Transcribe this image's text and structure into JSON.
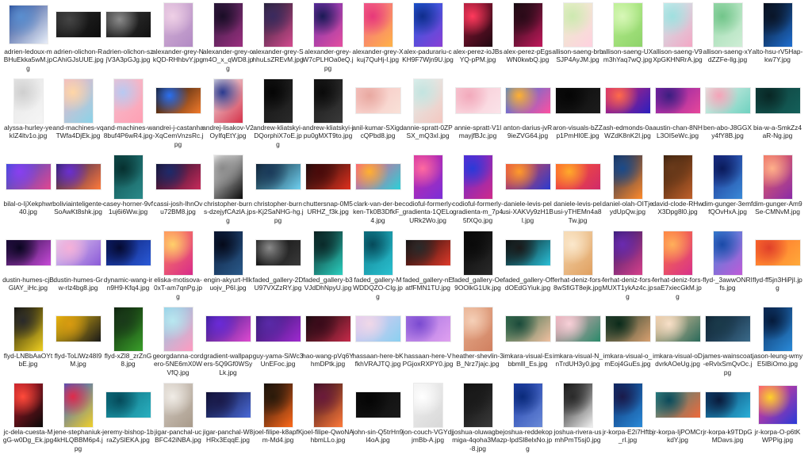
{
  "files": [
    {
      "name": "adrien-ledoux-mBHuEkka5wM.jpg",
      "shape": "square",
      "colors": [
        "#1f3f8f",
        "#e8eef8",
        "#5a8fd0"
      ]
    },
    {
      "name": "adrien-olichon-RCAhiGJsUUE.jpg",
      "shape": "landscape",
      "colors": [
        "#2a2a2a",
        "#0d0d0d",
        "#444444"
      ]
    },
    {
      "name": "adrien-olichon-szjV3A3pGJg.jpg",
      "shape": "landscape",
      "colors": [
        "#3a3a3a",
        "#111111",
        "#8a8a8a"
      ]
    },
    {
      "name": "alexander-grey-NkQD-RHhbvY.jpg",
      "shape": "portrait",
      "colors": [
        "#d9b8d8",
        "#b28ac4",
        "#efd0e6"
      ]
    },
    {
      "name": "alexander-grey-om4O_x_qWD8.jpg",
      "shape": "portrait",
      "colors": [
        "#2c1a3e",
        "#9b2f7f",
        "#1a0d26"
      ]
    },
    {
      "name": "alexander-grey-ShhuLsZREvM.jpg",
      "shape": "portrait",
      "colors": [
        "#1e1e30",
        "#d44b8f",
        "#3a2a5e"
      ]
    },
    {
      "name": "alexander-grey-W7cPLHOa0eQ.jpg",
      "shape": "portrait",
      "colors": [
        "#6a2fb0",
        "#e54fa0",
        "#1b1a55"
      ]
    },
    {
      "name": "alexander-grey-Xkuj7QuHj-I.jpg",
      "shape": "portrait",
      "colors": [
        "#f25f8e",
        "#ffb347",
        "#e7387a"
      ]
    },
    {
      "name": "alex-padurariu-cKH9F7Wjn9U.jpg",
      "shape": "portrait",
      "colors": [
        "#1d5fe0",
        "#8a3fd6",
        "#0f2d8c"
      ]
    },
    {
      "name": "alex-perez-ioJBsYQ-pPM.jpg",
      "shape": "portrait",
      "colors": [
        "#a01838",
        "#200812",
        "#ff3a5c"
      ]
    },
    {
      "name": "alex-perez-pEgsWN0kwbQ.jpg",
      "shape": "portrait",
      "colors": [
        "#0c0c0c",
        "#c2185b",
        "#2a0a18"
      ]
    },
    {
      "name": "allison-saeng-brbSJP4AyJM.jpg",
      "shape": "portrait",
      "colors": [
        "#e8f2c8",
        "#ffd1e0",
        "#cde9b0"
      ]
    },
    {
      "name": "allison-saeng-UXm3hYaq7wQ.jpg",
      "shape": "portrait",
      "colors": [
        "#b9ef8f",
        "#8ed36a",
        "#d8f7b8"
      ]
    },
    {
      "name": "allison-saeng-V9XpGKHNRrA.jpg",
      "shape": "portrait",
      "colors": [
        "#c6f0ef",
        "#f4a6c4",
        "#9fe0df"
      ]
    },
    {
      "name": "allison-saeng-xYdZZFe-llg.jpg",
      "shape": "portrait",
      "colors": [
        "#9ad9ac",
        "#cfeed6",
        "#72c58a"
      ]
    },
    {
      "name": "alto-hsu-rV5Hap-kw7Y.jpg",
      "shape": "portrait",
      "colors": [
        "#050a14",
        "#1f6fd1",
        "#0a1528"
      ]
    },
    {
      "name": "alyssa-hurley-yekIZ4ltv1o.jpg",
      "shape": "portrait",
      "colors": [
        "#e6e6e6",
        "#f5f5f5",
        "#cfcfcf"
      ]
    },
    {
      "name": "and-machines-vqTWfa4DjEk.jpg",
      "shape": "portrait",
      "colors": [
        "#f0b7c8",
        "#8ad3e8",
        "#ffd6a6"
      ]
    },
    {
      "name": "and-machines-w8buf4P6wR4.jpg",
      "shape": "portrait",
      "colors": [
        "#f2c2d0",
        "#ff9fb3",
        "#b8c9f2"
      ]
    },
    {
      "name": "andrei-j-castanha-XqCemVnzsRc.jpg",
      "shape": "landscape",
      "colors": [
        "#0a0a0a",
        "#f27a2a",
        "#2a6ff0"
      ]
    },
    {
      "name": "andrej-lisakov-V2OyIfqEtY.jpg",
      "shape": "portrait",
      "colors": [
        "#f2f2f2",
        "#d6324a",
        "#2a3a8f"
      ]
    },
    {
      "name": "andrew-kliatskyi-DQorphiX7oE.jpg",
      "shape": "portrait",
      "colors": [
        "#101010",
        "#2a2a2a",
        "#050505"
      ]
    },
    {
      "name": "andrew-kliatskyi-jpu0gMXT9to.jpg",
      "shape": "portrait",
      "colors": [
        "#151515",
        "#3a3a3a",
        "#0a0a0a"
      ]
    },
    {
      "name": "anil-kumar-SXigdcQPbd8.jpg",
      "shape": "landscape",
      "colors": [
        "#f6c3c0",
        "#f9e1d8",
        "#e8a8a0"
      ]
    },
    {
      "name": "annie-spratt-0ZPSX_mQ3xI.jpg",
      "shape": "portrait",
      "colors": [
        "#dff2ef",
        "#f4c7c0",
        "#c3e4e0"
      ]
    },
    {
      "name": "annie-spratt-V1lmayjfBJc.jpg",
      "shape": "landscape",
      "colors": [
        "#f7c7d2",
        "#fbe3e9",
        "#f2a9bb"
      ]
    },
    {
      "name": "anton-darius-jvR9ieZVG64.jpg",
      "shape": "landscape",
      "colors": [
        "#2f7de1",
        "#ff4fa0",
        "#ffb030"
      ]
    },
    {
      "name": "aron-visuals-bZZp1PmHI0E.jpg",
      "shape": "landscape",
      "colors": [
        "#0a0a0a",
        "#1c1c1c",
        "#050505"
      ]
    },
    {
      "name": "ash-edmonds-0aWZdK8nK2I.jpg",
      "shape": "landscape",
      "colors": [
        "#d6246e",
        "#2a1fbf",
        "#ff6a4a"
      ]
    },
    {
      "name": "austin-chan-8NHL3OI5eWc.jpg",
      "shape": "landscape",
      "colors": [
        "#7a1fa8",
        "#e8479a",
        "#3b1e80"
      ]
    },
    {
      "name": "ben-abo-J8GGXy4fY8B.jpg",
      "shape": "landscape",
      "colors": [
        "#e7f0e8",
        "#6ed2c0",
        "#f5a3b8"
      ]
    },
    {
      "name": "bia-w-a-SmkZz4aR-Ng.jpg",
      "shape": "landscape",
      "colors": [
        "#0e3d3a",
        "#14605a",
        "#082624"
      ]
    },
    {
      "name": "bilal-o-IjXekphwr40.jpg",
      "shape": "landscape",
      "colors": [
        "#2a4fd8",
        "#e2478f",
        "#8a3ff0"
      ]
    },
    {
      "name": "boliviainteligente-SoAwKt8shk.jpg",
      "shape": "landscape",
      "colors": [
        "#1a1a60",
        "#ff7a3a",
        "#6a2fd0"
      ]
    },
    {
      "name": "casey-horner-9vf1uj6i6Ww.jpg",
      "shape": "portrait",
      "colors": [
        "#0e4a4a",
        "#2a8a8a",
        "#06302f"
      ]
    },
    {
      "name": "cassi-josh-lhnOvu72BM8.jpg",
      "shape": "landscape",
      "colors": [
        "#0a0f2a",
        "#c82a5a",
        "#1e2a6a"
      ]
    },
    {
      "name": "christopher-burns-dzejyfCAzlA.jpg",
      "shape": "portrait",
      "colors": [
        "#ffffff",
        "#0a0a0a",
        "#8a8a8a"
      ]
    },
    {
      "name": "christopher-burns-Kj2SaNHG-hg.jpg",
      "shape": "landscape",
      "colors": [
        "#0a1a2a",
        "#6fd0f0",
        "#1a3a5a"
      ]
    },
    {
      "name": "chuttersnap-0M5URHZ_f3k.jpg",
      "shape": "landscape",
      "colors": [
        "#0a0a0a",
        "#e0301e",
        "#4a0a0a"
      ]
    },
    {
      "name": "clark-van-der-beken-Tk0B3DfkF_4.jpg",
      "shape": "landscape",
      "colors": [
        "#ff4f8a",
        "#2ad0d8",
        "#ffb030"
      ]
    },
    {
      "name": "codioful-formerly-gradienta-1QELoURk2Wo.jpg",
      "shape": "portrait",
      "colors": [
        "#d02aa0",
        "#7a2fd8",
        "#ff6aa0"
      ]
    },
    {
      "name": "codioful-formerly-gradienta-m_7p45fXQo.jpg",
      "shape": "portrait",
      "colors": [
        "#5a2ad8",
        "#d02a8a",
        "#2a3ad8"
      ]
    },
    {
      "name": "daniele-levis-pelusi-XAKVy9zH1Bl.jpg",
      "shape": "landscape",
      "colors": [
        "#f04a3a",
        "#2a3ad0",
        "#ff9a2a"
      ]
    },
    {
      "name": "daniele-levis-pelusi-yTHEMn4a8Tw.jpg",
      "shape": "landscape",
      "colors": [
        "#ff5a2a",
        "#d02a6a",
        "#ffaa2a"
      ]
    },
    {
      "name": "daniel-olah-OITjeydUpQw.jpg",
      "shape": "portrait",
      "colors": [
        "#0a2a5a",
        "#ff8a2a",
        "#1a4a8a"
      ]
    },
    {
      "name": "david-clode-RHwX3Dpg8l0.jpg",
      "shape": "portrait",
      "colors": [
        "#2a1a0a",
        "#c0602a",
        "#6a3a1a"
      ]
    },
    {
      "name": "dim-gunger-3emffQOvHxA.jpg",
      "shape": "portrait",
      "colors": [
        "#1a2a8a",
        "#3a8ad8",
        "#0a1a5a"
      ]
    },
    {
      "name": "dim-gunger-Am9Se-CMNvM.jpg",
      "shape": "portrait",
      "colors": [
        "#f06a5a",
        "#8a2aa8",
        "#ffb08a"
      ]
    },
    {
      "name": "dustin-humes-cjBGlAY_iHc.jpg",
      "shape": "landscape",
      "colors": [
        "#1a0a3a",
        "#c84ad8",
        "#0a0520"
      ]
    },
    {
      "name": "dustin-humes-Grw-rlz4bg8.jpg",
      "shape": "landscape",
      "colors": [
        "#e8d0f0",
        "#8a5ad8",
        "#f5b0d8"
      ]
    },
    {
      "name": "dynamic-wang-irn9H9-Kfq4.jpg",
      "shape": "landscape",
      "colors": [
        "#0a1a6a",
        "#2a5ad8",
        "#050a30"
      ]
    },
    {
      "name": "eliska-motisova-0xT-am7qnPg.jpg",
      "shape": "portrait",
      "colors": [
        "#ff8a5a",
        "#d82a8a",
        "#ffd06a"
      ]
    },
    {
      "name": "engin-akyurt-Hlkuojv_P6I.jpg",
      "shape": "portrait",
      "colors": [
        "#0a1a3a",
        "#2a5a8a",
        "#050a1a"
      ]
    },
    {
      "name": "faded_gallery-2DU97VXZzRY.jpg",
      "shape": "landscape",
      "colors": [
        "#0a0a0a",
        "#3a3a3a",
        "#8a8a8a"
      ]
    },
    {
      "name": "faded_gallery-b3VJdDhNpyU.jpg",
      "shape": "portrait",
      "colors": [
        "#0a1a1a",
        "#2ad0c0",
        "#0a2a2a"
      ]
    },
    {
      "name": "faded_gallery-MWDDQZO-CIg.jpg",
      "shape": "portrait",
      "colors": [
        "#0e7a8a",
        "#2ac0d0",
        "#064a5a"
      ]
    },
    {
      "name": "faded_gallery-nEatfFMN1TU.jpg",
      "shape": "landscape",
      "colors": [
        "#0a0a0a",
        "#e03a2a",
        "#2a2a2a"
      ]
    },
    {
      "name": "faded_gallery-Oe9OOlkG1Uk.jpg",
      "shape": "portrait",
      "colors": [
        "#050505",
        "#2a2a2a",
        "#0a0a0a"
      ]
    },
    {
      "name": "faded_gallery-OfdOEdGYiuk.jpg",
      "shape": "landscape",
      "colors": [
        "#0a0a0a",
        "#2ac0d8",
        "#1a1a1a"
      ]
    },
    {
      "name": "ferhat-deniz-fors-8wSfiGT8ejk.jpg",
      "shape": "portrait",
      "colors": [
        "#f5d8b0",
        "#e0a060",
        "#fbe8cc"
      ]
    },
    {
      "name": "ferhat-deniz-fors-MUXT1ykAz4c.jpg",
      "shape": "portrait",
      "colors": [
        "#2a1a6a",
        "#d8408a",
        "#6a2ab0"
      ]
    },
    {
      "name": "ferhat-deniz-fors-saE7xiecGkM.jpg",
      "shape": "portrait",
      "colors": [
        "#ff7a3a",
        "#d8308a",
        "#ffb05a"
      ]
    },
    {
      "name": "flyd-_3awwONRIfs.jpg",
      "shape": "portrait",
      "colors": [
        "#3a8ad8",
        "#c05ad8",
        "#1a4aa8"
      ]
    },
    {
      "name": "flyd-ff5jn3HiPjI.jpg",
      "shape": "landscape",
      "colors": [
        "#ff6a2a",
        "#ffaa3a",
        "#e0402a"
      ]
    },
    {
      "name": "flyd-LNBbAaOYtbE.jpg",
      "shape": "portrait",
      "colors": [
        "#0a0a0a",
        "#f0d020",
        "#2a2a2a"
      ]
    },
    {
      "name": "flyd-ToLlWz48I9M.jpg",
      "shape": "landscape",
      "colors": [
        "#f0c010",
        "#1a1a1a",
        "#d89a10"
      ]
    },
    {
      "name": "flyd-xZl8_zrZnG8.jpg",
      "shape": "portrait",
      "colors": [
        "#0a1a0a",
        "#3aa02a",
        "#1a3a1a"
      ]
    },
    {
      "name": "georgdanna-cordero-5NE6mX0WVfQ.jpg",
      "shape": "portrait",
      "colors": [
        "#8ad0e8",
        "#ff9ac0",
        "#b8e8f0"
      ]
    },
    {
      "name": "gradient-wallpapers-5Q9Gf0WSyLk.jpg",
      "shape": "landscape",
      "colors": [
        "#2a1a8a",
        "#e04ad0",
        "#6a2ad8"
      ]
    },
    {
      "name": "guy-yama-SiWc3UnEFoc.jpg",
      "shape": "landscape",
      "colors": [
        "#2a1a6a",
        "#a02ad0",
        "#5a2aa8"
      ]
    },
    {
      "name": "hao-wang-pVq6YhmDPtk.jpg",
      "shape": "landscape",
      "colors": [
        "#0a0a0a",
        "#c82a4a",
        "#3a0a1a"
      ]
    },
    {
      "name": "hassaan-here-bKfkhVRAJTQ.jpg",
      "shape": "landscape",
      "colors": [
        "#e8c8f0",
        "#8ad0f0",
        "#f0d8e8"
      ]
    },
    {
      "name": "hassaan-here-VPGjoxRXPY0.jpg",
      "shape": "landscape",
      "colors": [
        "#a070e0",
        "#e0a0f0",
        "#7a4ad0"
      ]
    },
    {
      "name": "heather-shevlin-3B_Nrz7jajc.jpg",
      "shape": "portrait",
      "colors": [
        "#e8b090",
        "#d08060",
        "#f5d0b8"
      ]
    },
    {
      "name": "imkara-visual-Esbbmlll_Es.jpg",
      "shape": "landscape",
      "colors": [
        "#2a6a4a",
        "#f0c0a0",
        "#1a4a3a"
      ]
    },
    {
      "name": "imkara-visual-N_nTrdUH3y0.jpg",
      "shape": "landscape",
      "colors": [
        "#f0a8b8",
        "#2a8a6a",
        "#f8d0d8"
      ]
    },
    {
      "name": "imkara-visual-o_mEoj4GuEs.jpg",
      "shape": "landscape",
      "colors": [
        "#1a3a2a",
        "#d8a070",
        "#0a2a1a"
      ]
    },
    {
      "name": "imkara-visual-oDdvrkAOeUg.jpg",
      "shape": "landscape",
      "colors": [
        "#f0c8a0",
        "#2a6a5a",
        "#f8e0c8"
      ]
    },
    {
      "name": "james-wainscoat-eRvlxSmQvOc.jpg",
      "shape": "landscape",
      "colors": [
        "#0a1a2a",
        "#3a6a8a",
        "#1a3a4a"
      ]
    },
    {
      "name": "jason-leung-wmyE5lBiOmo.jpg",
      "shape": "portrait",
      "colors": [
        "#0a2a5a",
        "#2a8ad8",
        "#051a3a"
      ]
    },
    {
      "name": "jc-dela-cuesta-MgG-w0Dg_Ek.jpg",
      "shape": "portrait",
      "colors": [
        "#c01a2a",
        "#0a0a0a",
        "#ff4a3a"
      ]
    },
    {
      "name": "jene-stephaniuk-4kHLQBBM6p4.jpg",
      "shape": "portrait",
      "colors": [
        "#2a5ad8",
        "#f0d02a",
        "#e02a4a"
      ]
    },
    {
      "name": "jeremy-bishop-1braZySlEKA.jpg",
      "shape": "landscape",
      "colors": [
        "#0a6a7a",
        "#2ab0c0",
        "#054a5a"
      ]
    },
    {
      "name": "jigar-panchal-ucBFC42iNBA.jpg",
      "shape": "portrait",
      "colors": [
        "#d8d0c8",
        "#a89a8a",
        "#f0ece6"
      ]
    },
    {
      "name": "jigar-panchal-W8HRx3EqqE.jpg",
      "shape": "landscape",
      "colors": [
        "#0a0a2a",
        "#4a6ad8",
        "#1a1a4a"
      ]
    },
    {
      "name": "joel-filipe-k8apfKm-Md4.jpg",
      "shape": "portrait",
      "colors": [
        "#0a0a0a",
        "#ff6a1a",
        "#2a1a0a"
      ]
    },
    {
      "name": "joel-filipe-QwoNAhbmLLo.jpg",
      "shape": "portrait",
      "colors": [
        "#2a0a1a",
        "#ff7a3a",
        "#6a1a3a"
      ]
    },
    {
      "name": "john-sin-Q5trHn9l4oA.jpg",
      "shape": "landscape",
      "colors": [
        "#0a0a0a",
        "#1a1a1a",
        "#050505"
      ]
    },
    {
      "name": "jon-couch-VGYdjjmBb-A.jpg",
      "shape": "portrait",
      "colors": [
        "#f0f0f0",
        "#d8d8d8",
        "#ffffff"
      ]
    },
    {
      "name": "joshua-oluwagbemiga-4qoha3Maz-8.jpg",
      "shape": "portrait",
      "colors": [
        "#0a0a0a",
        "#3a3a3a",
        "#1a1a1a"
      ]
    },
    {
      "name": "joshua-reddekopp-IpdSl8elxNo.jpg",
      "shape": "portrait",
      "colors": [
        "#1a3aa8",
        "#6a8ad8",
        "#0a2a7a"
      ]
    },
    {
      "name": "joshua-rivera-usmhPmT5sj0.jpg",
      "shape": "portrait",
      "colors": [
        "#0a0a0a",
        "#f0f0f0",
        "#2a2a2a"
      ]
    },
    {
      "name": "jr-korpa-E2i7Hftb_rI.jpg",
      "shape": "portrait",
      "colors": [
        "#0a2a6a",
        "#2a8ad8",
        "#1a1a4a"
      ]
    },
    {
      "name": "jr-korpa-IjPOMCrkdY.jpg",
      "shape": "landscape",
      "colors": [
        "#2a8a8a",
        "#f06a3a",
        "#0a4a5a"
      ]
    },
    {
      "name": "jr-korpa-k9TDpGMDavs.jpg",
      "shape": "landscape",
      "colors": [
        "#0a3a6a",
        "#2ab0d8",
        "#0a1a3a"
      ]
    },
    {
      "name": "jr-korpa-O-p6tKWPPig.jpg",
      "shape": "square",
      "colors": [
        "#ff3a8a",
        "#2a3ad8",
        "#ffd02a"
      ]
    }
  ]
}
